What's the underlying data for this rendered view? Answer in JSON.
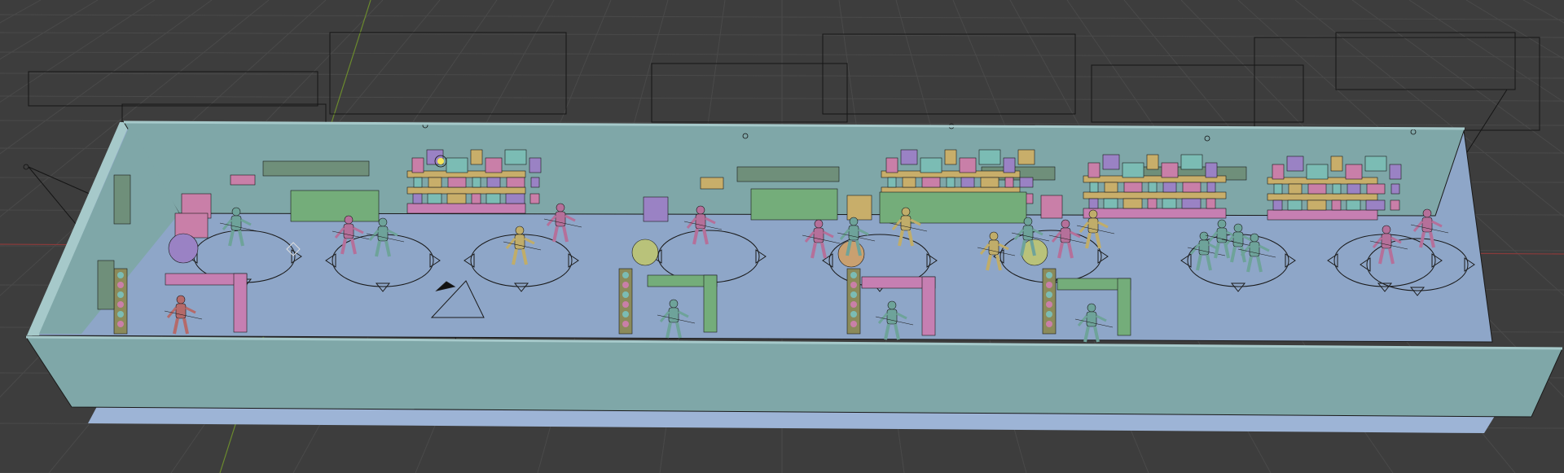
{
  "viewport": {
    "background_color": "#3d3d3d",
    "grid_color": "#4a4a4a",
    "x_axis_color": "#8a3b3b",
    "y_axis_color": "#6b8a2e"
  },
  "scene": {
    "colors": {
      "wall": "#7fa7a8",
      "wall_top": "#a6c9ca",
      "floor": "#8ea6c8",
      "floor_shadow": "#9db4d6",
      "lines": "#1a1a1a",
      "shelf_green": "#74ad7a",
      "shelf_pink": "#c67fb2",
      "box_pink": "#c97fa8",
      "box_purple": "#9a82c4",
      "box_teal": "#7bbcb4",
      "box_tan": "#c8ae6a",
      "char_teal": "#6ea39a",
      "char_pink": "#b5709a",
      "char_yellow": "#c0ad6a"
    },
    "camera_icon": "camera-icon",
    "light_icon": "light-icon",
    "light_dot_color": "#f2e55a"
  }
}
